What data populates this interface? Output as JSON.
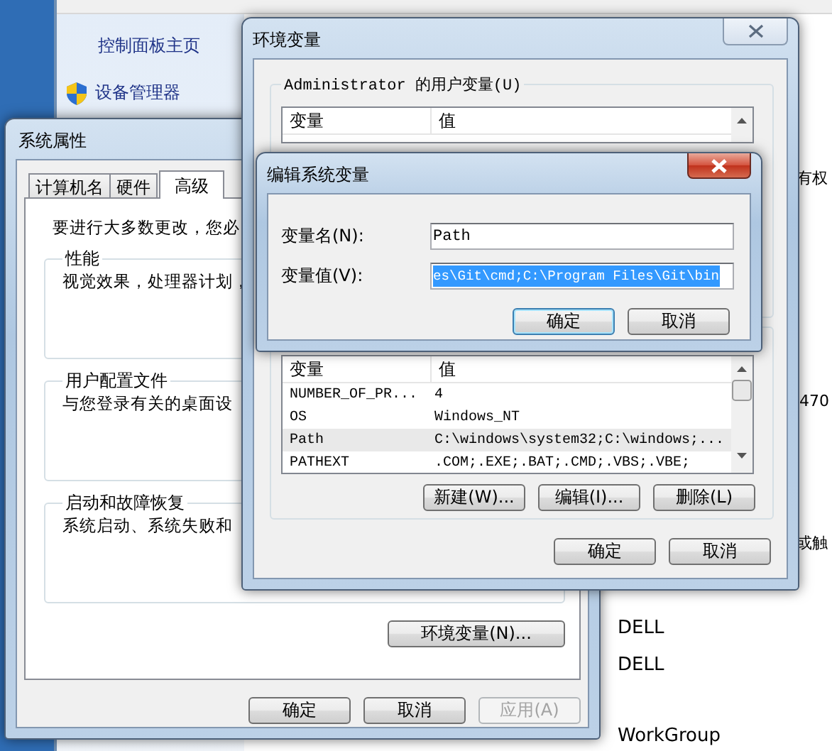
{
  "control_panel": {
    "sidebar_items": [
      {
        "label": "控制面板主页",
        "kind": "link"
      },
      {
        "label": "设备管理器",
        "kind": "shield"
      }
    ],
    "details": [
      "有权",
      "470",
      "或触",
      "DELL",
      "DELL",
      "WorkGroup"
    ]
  },
  "system_properties": {
    "title": "系统属性",
    "tabs": [
      {
        "label": "计算机名",
        "selected": false
      },
      {
        "label": "硬件",
        "selected": false
      },
      {
        "label": "高级",
        "selected": true
      }
    ],
    "intro": "要进行大多数更改，您必",
    "groups": [
      {
        "title": "性能",
        "text": "视觉效果，处理器计划，"
      },
      {
        "title": "用户配置文件",
        "text": "与您登录有关的桌面设"
      },
      {
        "title": "启动和故障恢复",
        "text": "系统启动、系统失败和"
      }
    ],
    "env_button": "环境变量(N)...",
    "buttons": [
      {
        "label": "确定",
        "disabled": false
      },
      {
        "label": "取消",
        "disabled": false
      },
      {
        "label": "应用(A)",
        "disabled": true
      }
    ]
  },
  "environment_variables": {
    "title": "环境变量",
    "user_group": "Administrator 的用户变量(U)",
    "user_columns": [
      "变量",
      "值"
    ],
    "system_columns": [
      "变量",
      "值"
    ],
    "system_rows": [
      {
        "name": "NUMBER_OF_PR...",
        "value": "4",
        "selected": false
      },
      {
        "name": "OS",
        "value": "Windows_NT",
        "selected": false
      },
      {
        "name": "Path",
        "value": "C:\\windows\\system32;C:\\windows;...",
        "selected": true
      },
      {
        "name": "PATHEXT",
        "value": ".COM;.EXE;.BAT;.CMD;.VBS;.VBE;",
        "selected": false
      }
    ],
    "system_buttons": [
      "新建(W)...",
      "编辑(I)...",
      "删除(L)"
    ],
    "buttons": [
      "确定",
      "取消"
    ]
  },
  "edit_dialog": {
    "title": "编辑系统变量",
    "fields": [
      {
        "label": "变量名(N):",
        "value": "Path",
        "selected": false
      },
      {
        "label": "变量值(V):",
        "value": "es\\Git\\cmd;C:\\Program Files\\Git\\bin",
        "selected": true
      }
    ],
    "buttons": [
      {
        "label": "确定",
        "default": true
      },
      {
        "label": "取消",
        "default": false
      }
    ]
  }
}
